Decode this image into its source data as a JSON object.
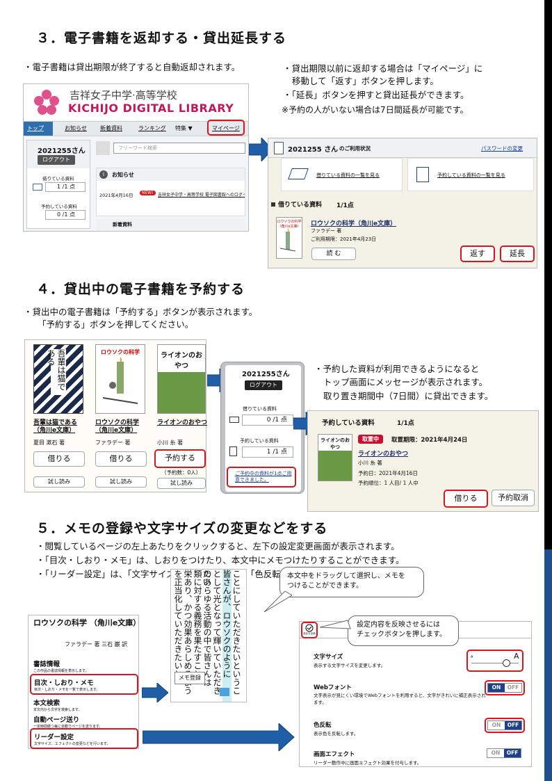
{
  "s3": {
    "title": "３．電子書籍を返却する・貸出延長する",
    "note_left": "・電子書籍は貸出期限が終了すると自動返却されます。",
    "note_r1": "・貸出期限以前に返却する場合は「マイページ」に",
    "note_r2": "移動して「返す」ボタンを押します。",
    "note_r3": "・「延長」ボタンを押すと貸出延長ができます。",
    "note_r4": "※予約の人がいない場合は7日間延長が可能です。",
    "lib_name_jp": "吉祥女子中学·高等学校",
    "lib_name_en": "KICHIJO DIGITAL LIBRARY",
    "nav": [
      "トップ",
      "お知らせ",
      "新着資料",
      "ランキング",
      "特集 ▼",
      "マイページ"
    ],
    "user": "2021255さん",
    "logout": "ログアウト",
    "borrowing_label": "借りている資料",
    "borrowing_count": "1 /1 点",
    "reserved_label": "予約している資料",
    "reserved_count": "0 /1 点",
    "search_placeholder": "フリーワード検索",
    "news_title": "お知らせ",
    "news_date": "2021年4月16日",
    "news_badge": "NEW!",
    "news_text": "吉祥女子中学・高等学校 電子図書館へのログイン",
    "new_arrivals": "新着資料",
    "mp_user": "2021255 さん",
    "mp_status": "のご利用状況",
    "mp_pw": "パスワードの変更",
    "mp_link1": "借りている資料の一覧を見る",
    "mp_link2": "予約している資料の一覧を見る",
    "mp_borrow_head": "借りている資料",
    "mp_borrow_count": "1/1点",
    "mp_book_title": "ロウソクの科学（角川e文庫）",
    "mp_book_author": "ファラデー 著",
    "mp_book_due": "ご利用期限：2021年4月23日",
    "mp_read": "読 む",
    "mp_return": "返す",
    "mp_extend": "延長"
  },
  "s4": {
    "title": "４．貸出中の電子書籍を予約する",
    "note1": "・貸出中の電子書籍は「予約する」ボタンが表示されます。",
    "note2": "「予約する」ボタンを押してください。",
    "books": [
      {
        "title": "吾輩は猫である（角川e文庫）",
        "author": "夏目 漱石 著",
        "action": "借りる",
        "trial": "試し読み",
        "cover": "吾輩は猫である"
      },
      {
        "title": "ロウソクの科学（角川e文庫）",
        "author": "ファラデー 著",
        "action": "借りる",
        "trial": "試し読み",
        "cover": "ロウソクの科学"
      },
      {
        "title": "ライオンのおやつ",
        "author": "小川 糸 著",
        "action": "予約する",
        "trial": "試し読み",
        "cover": "ライオンのおやつ"
      }
    ],
    "reserve_count": "（予約数：0人）",
    "side_user": "2021255さん",
    "side_logout": "ログアウト",
    "side_borrow_label": "借りている資料",
    "side_borrow_count": "0 /1 点",
    "side_reserve_label": "予約している資料",
    "side_reserve_count": "1 /1 点",
    "side_msg": "ご予約中の資料が1点ご用意できました。",
    "note_r1": "・予約した資料が利用できるようになると",
    "note_r2": "トップ画面にメッセージが表示されます。",
    "note_r3": "取り置き期間中（7日間）に貸出できます。",
    "rs_head": "予約している資料",
    "rs_count": "1/1点",
    "rs_badge": "取置中",
    "rs_period": "取置期限：2021年4月24日",
    "rs_book": "ライオンのおやつ",
    "rs_author": "小川 糸 著",
    "rs_date": "予約日：2021年4月16日",
    "rs_order": "予約順位：1 人目/ 1 人中",
    "rs_borrow": "借りる",
    "rs_cancel": "予約取消"
  },
  "s5": {
    "title": "５．メモの登録や文字サイズの変更などをする",
    "note1": "・閲覧しているページの左上あたりをクリックすると、左下の設定変更画面が表示されます。",
    "note2": "・「目次・しおり・メモ」は、しおりをつけたり、本文中にメモつけたりすることができます。",
    "note3": "・「リーダー設定」は、「文字サイズ」「Webフォント」「色反転」などの変更ができます。",
    "menu_book": "ロウソクの科学 （角川e文庫）",
    "menu_author": "ファラデー 著 三石 巌 訳",
    "menu_items": [
      {
        "label": "書誌情報",
        "desc": "この作品の書誌情報を表示します。"
      },
      {
        "label": "目次・しおり・メモ",
        "desc": "目次・しおり・メモを一覧で表示します。"
      },
      {
        "label": "本文検索",
        "desc": "本文内から文字を検索します。"
      },
      {
        "label": "自動ページ送り",
        "desc": "一定時間経つ毎に自動でページを送ります。"
      },
      {
        "label": "リーダー設定",
        "desc": "文字サイズ、エフェクトの変更などを行います。"
      }
    ],
    "memo_btn": "メモ登録",
    "callout1": "本文中をドラッグして選択し、メモを\nつけることができます。",
    "callout2": "設定内容を反映させるには\nチェックボタンを押します。",
    "settings_label": "設定を反映",
    "settings": [
      {
        "label": "文字サイズ",
        "desc": "表示する文字サイズを変更します。"
      },
      {
        "label": "Webフォント",
        "desc": "文字表示が見にくい環境でWebフォントを利用すると、文字がきれいに補正表示されます。"
      },
      {
        "label": "色反転",
        "desc": "表示色を反転します。"
      },
      {
        "label": "画面エフェクト",
        "desc": "リーダー動作中に画面エフェクト効果を付与します。"
      }
    ],
    "on": "ON",
    "off": "OFF"
  }
}
